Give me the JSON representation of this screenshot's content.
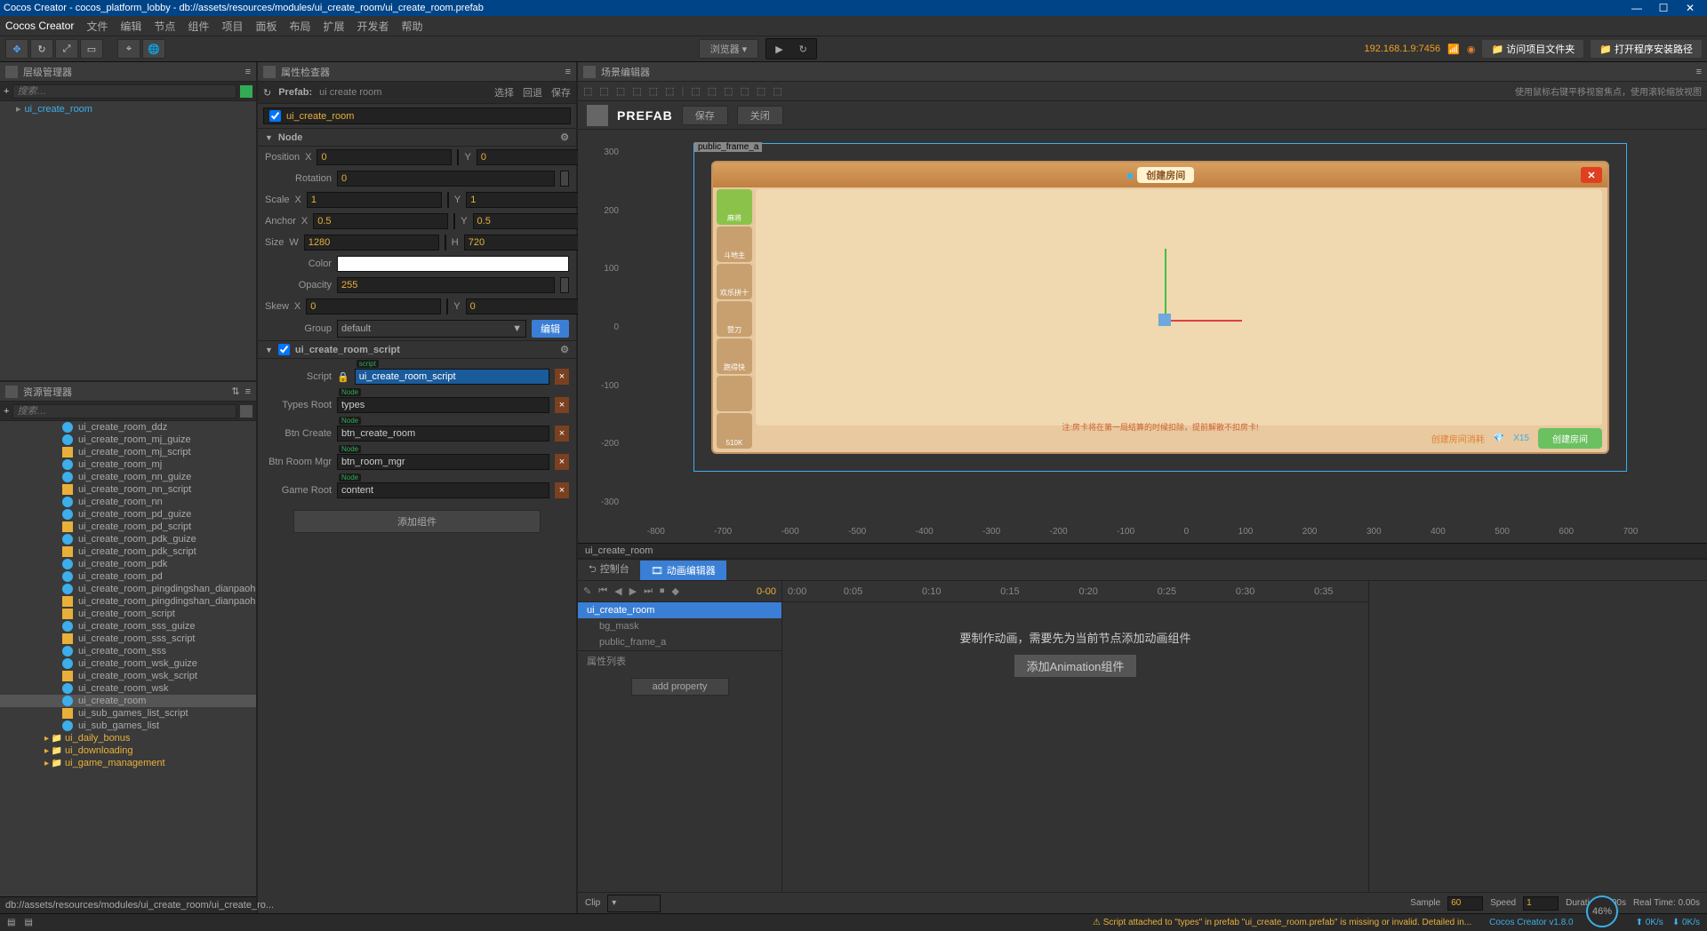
{
  "title": "Cocos Creator - cocos_platform_lobby - db://assets/resources/modules/ui_create_room/ui_create_room.prefab",
  "app": "Cocos Creator",
  "menu": [
    "文件",
    "编辑",
    "节点",
    "组件",
    "项目",
    "面板",
    "布局",
    "扩展",
    "开发者",
    "帮助"
  ],
  "toolbar": {
    "browser": "浏览器 ▾",
    "ip": "192.168.1.9:7456",
    "open_folder": "📁 访问项目文件夹",
    "install_path": "📁 打开程序安装路径"
  },
  "hierarchy": {
    "title": "层级管理器",
    "search": "搜索…",
    "root": "ui_create_room"
  },
  "assets": {
    "title": "资源管理器",
    "search": "搜索…",
    "items": [
      {
        "n": "ui_create_room_ddz",
        "t": "prefab"
      },
      {
        "n": "ui_create_room_mj_guize",
        "t": "prefab"
      },
      {
        "n": "ui_create_room_mj_script",
        "t": "js"
      },
      {
        "n": "ui_create_room_mj",
        "t": "prefab"
      },
      {
        "n": "ui_create_room_nn_guize",
        "t": "prefab"
      },
      {
        "n": "ui_create_room_nn_script",
        "t": "js"
      },
      {
        "n": "ui_create_room_nn",
        "t": "prefab"
      },
      {
        "n": "ui_create_room_pd_guize",
        "t": "prefab"
      },
      {
        "n": "ui_create_room_pd_script",
        "t": "js"
      },
      {
        "n": "ui_create_room_pdk_guize",
        "t": "prefab"
      },
      {
        "n": "ui_create_room_pdk_script",
        "t": "js"
      },
      {
        "n": "ui_create_room_pdk",
        "t": "prefab"
      },
      {
        "n": "ui_create_room_pd",
        "t": "prefab"
      },
      {
        "n": "ui_create_room_pingdingshan_dianpaohu",
        "t": "prefab"
      },
      {
        "n": "ui_create_room_pingdingshan_dianpaohu",
        "t": "js"
      },
      {
        "n": "ui_create_room_script",
        "t": "js"
      },
      {
        "n": "ui_create_room_sss_guize",
        "t": "prefab"
      },
      {
        "n": "ui_create_room_sss_script",
        "t": "js"
      },
      {
        "n": "ui_create_room_sss",
        "t": "prefab"
      },
      {
        "n": "ui_create_room_wsk_guize",
        "t": "prefab"
      },
      {
        "n": "ui_create_room_wsk_script",
        "t": "js"
      },
      {
        "n": "ui_create_room_wsk",
        "t": "prefab"
      },
      {
        "n": "ui_create_room",
        "t": "prefab",
        "sel": true
      },
      {
        "n": "ui_sub_games_list_script",
        "t": "js"
      },
      {
        "n": "ui_sub_games_list",
        "t": "prefab"
      }
    ],
    "folders": [
      "ui_daily_bonus",
      "ui_downloading",
      "ui_game_management"
    ],
    "path": "db://assets/resources/modules/ui_create_room/ui_create_ro..."
  },
  "inspector": {
    "title": "属性检查器",
    "prefab_label": "Prefab:",
    "prefab_name": "ui create room",
    "links": [
      "选择",
      "回退",
      "保存"
    ],
    "node_name": "ui_create_room",
    "sections": {
      "node": "Node",
      "script": "ui_create_room_script"
    },
    "props": {
      "position": "Position",
      "pos_x": "0",
      "pos_y": "0",
      "rotation": "Rotation",
      "rot": "0",
      "scale": "Scale",
      "sc_x": "1",
      "sc_y": "1",
      "anchor": "Anchor",
      "an_x": "0.5",
      "an_y": "0.5",
      "size": "Size",
      "sz_w": "1280",
      "sz_h": "720",
      "color": "Color",
      "opacity": "Opacity",
      "op": "255",
      "skew": "Skew",
      "sk_x": "0",
      "sk_y": "0",
      "group": "Group",
      "group_v": "default",
      "group_btn": "编辑"
    },
    "script_props": {
      "script": "Script",
      "script_v": "ui_create_room_script",
      "script_tag": "script",
      "types": "Types Root",
      "types_v": "types",
      "types_tag": "Node",
      "btncreate": "Btn Create",
      "btncreate_v": "btn_create_room",
      "btncreate_tag": "Node",
      "btnroom": "Btn Room Mgr",
      "btnroom_v": "btn_room_mgr",
      "btnroom_tag": "Node",
      "gameroot": "Game Root",
      "gameroot_v": "content",
      "gameroot_tag": "Node"
    },
    "add_component": "添加组件"
  },
  "scene": {
    "title": "场景编辑器",
    "prefab": "PREFAB",
    "save": "保存",
    "close": "关闭",
    "hint": "使用鼠标右键平移视窗焦点，使用滚轮缩放视图",
    "node_path": "ui_create_room",
    "frame_label": "public_frame_a",
    "ruler_v": [
      "300",
      "200",
      "100",
      "0",
      "-100",
      "-200",
      "-300"
    ],
    "ruler_h": [
      "-800",
      "-700",
      "-600",
      "-500",
      "-400",
      "-300",
      "-200",
      "-100",
      "0",
      "100",
      "200",
      "300",
      "400",
      "500",
      "600",
      "700"
    ],
    "preview": {
      "title": "创建房间",
      "tabs": [
        "麻将",
        "斗地主",
        "欢乐拼十",
        "赞刀",
        "跑得快",
        "",
        "510K"
      ],
      "footer_cost": "创建房间消耗",
      "footer_x": "X15",
      "footer_note": "注:房卡将在第一局结算的时候扣除，提前解散不扣房卡!",
      "create": "创建房间"
    }
  },
  "anim": {
    "tabs": {
      "console": "控制台",
      "anim": "动画编辑器"
    },
    "time": "0-00",
    "time2": "0:00",
    "ticks": [
      "0:05",
      "0:10",
      "0:15",
      "0:20",
      "0:25",
      "0:30",
      "0:35"
    ],
    "rows": [
      "ui_create_room",
      "bg_mask",
      "public_frame_a"
    ],
    "proplist": "属性列表",
    "addprop": "add property",
    "msg": "要制作动画，需要先为当前节点添加动画组件",
    "addanim": "添加Animation组件",
    "clip": "Clip",
    "sample": "Sample",
    "sample_v": "60",
    "speed": "Speed",
    "speed_v": "1",
    "duration": "Duration: 0.00s",
    "realtime": "Real Time: 0.00s"
  },
  "status": {
    "warn": "⚠ Script attached to \"types\" in prefab \"ui_create_room.prefab\" is missing or invalid. Detailed in...",
    "brand": "Cocos Creator v1.8.0",
    "pct": "46%",
    "kps1": "0K/s",
    "kps2": "0K/s"
  }
}
